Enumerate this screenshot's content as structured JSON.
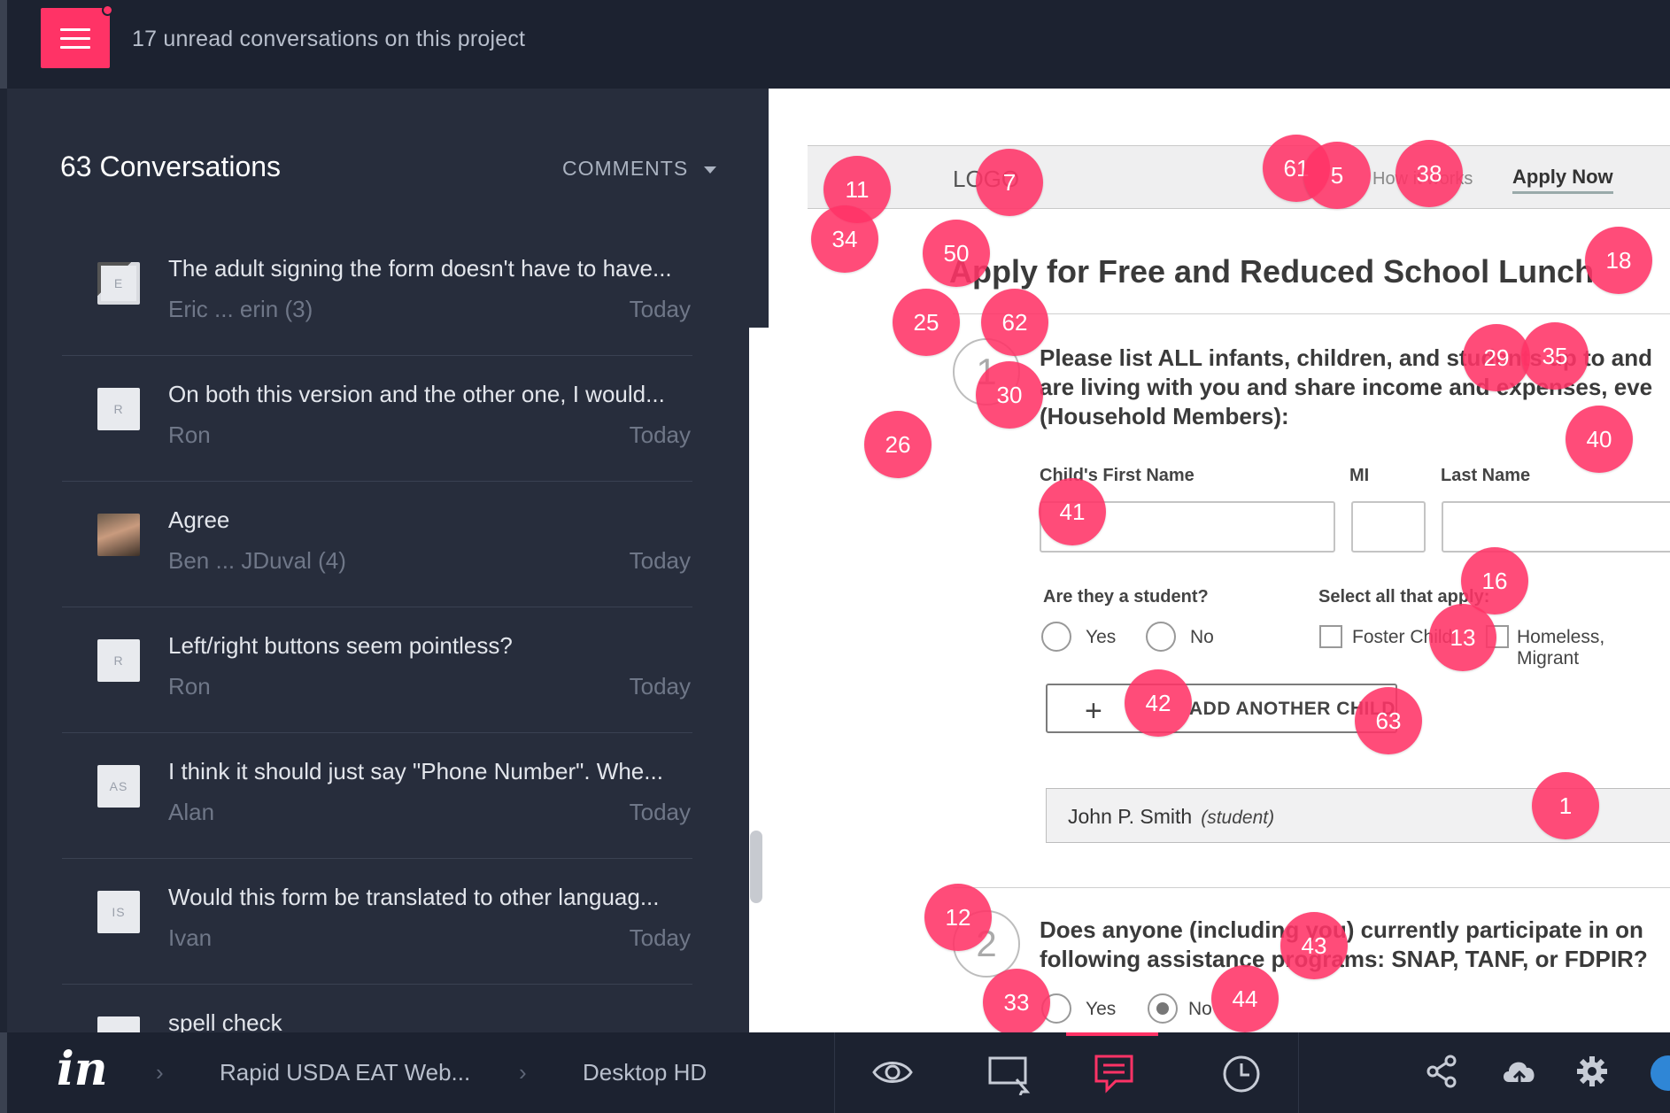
{
  "topbar": {
    "unread_text": "17 unread conversations on this project"
  },
  "sidebar": {
    "title": "63 Conversations",
    "filter_label": "COMMENTS",
    "conversations": [
      {
        "avatar": "E",
        "text": "The adult signing the form doesn't have to have...",
        "author": "Eric ... erin (3)",
        "time": "Today"
      },
      {
        "avatar": "R",
        "text": "On both this version and the other one, I would...",
        "author": "Ron",
        "time": "Today"
      },
      {
        "avatar": "",
        "text": "Agree",
        "author": "Ben ... JDuval (4)",
        "time": "Today"
      },
      {
        "avatar": "R",
        "text": "Left/right buttons seem pointless?",
        "author": "Ron",
        "time": "Today"
      },
      {
        "avatar": "AS",
        "text": "I think it should just say \"Phone Number\". Whe...",
        "author": "Alan",
        "time": "Today"
      },
      {
        "avatar": "IS",
        "text": "Would this form be translated to other languag...",
        "author": "Ivan",
        "time": "Today"
      },
      {
        "avatar": "",
        "text": "spell check",
        "author": "",
        "time": ""
      }
    ]
  },
  "canvas": {
    "logo": "LOGO",
    "nav_link": "How it works",
    "apply_now": "Apply Now",
    "form_title": "Apply for Free and Reduced School Lunch",
    "step1": "1",
    "q1_line1": "Please list ALL infants, children, and students up to and",
    "q1_line2": "are living with you and share income and expenses, eve",
    "q1_line3": "(Household Members):",
    "label_first": "Child's First Name",
    "label_mi": "MI",
    "label_last": "Last Name",
    "label_student": "Are they a student?",
    "opt_yes": "Yes",
    "opt_no": "No",
    "label_select": "Select all that apply:",
    "opt_foster": "Foster Child",
    "opt_homeless": "Homeless, Migrant",
    "add_child_plus": "+",
    "add_child_label": "ADD ANOTHER CHILD",
    "child_name": "John P. Smith",
    "child_tag": "(student)",
    "step2": "2",
    "q2_line1": "Does anyone (including you) currently participate in on",
    "q2_line2": "following assistance programs: SNAP, TANF, or FDPIR?",
    "q2_yes": "Yes",
    "q2_no": "No",
    "pins": [
      "11",
      "7",
      "61",
      "5",
      "38",
      "34",
      "50",
      "18",
      "25",
      "62",
      "29",
      "35",
      "30",
      "26",
      "40",
      "41",
      "16",
      "13",
      "42",
      "63",
      "1",
      "12",
      "43",
      "33",
      "44"
    ]
  },
  "bottombar": {
    "logo": "in",
    "crumb_project": "Rapid USDA EAT Web...",
    "crumb_screen": "Desktop HD",
    "icons": [
      "preview-eye-icon",
      "inspect-screen-icon",
      "comments-icon",
      "history-clock-icon",
      "share-icon",
      "sync-cloud-icon",
      "settings-gear-icon"
    ],
    "active_tool": "comments-icon",
    "accent": "#ff3366"
  }
}
